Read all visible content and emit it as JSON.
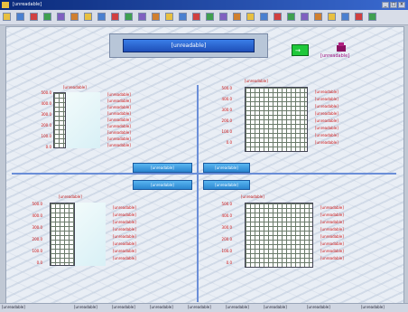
{
  "window": {
    "title": "[unreadable]",
    "controls": [
      "_",
      "□",
      "×"
    ]
  },
  "toolbar": {
    "icons": [
      "open-icon",
      "save-icon",
      "print-icon",
      "copy-icon",
      "cut-icon",
      "paste-icon",
      "undo-icon",
      "redo-icon",
      "arrow-icon",
      "arrow-icon",
      "arrow-icon",
      "arrow-icon",
      "zoom-icon",
      "zoom-icon",
      "chart-icon",
      "window-icon",
      "window-icon",
      "window-icon",
      "grid-icon",
      "table-icon",
      "folder-icon",
      "disk-icon",
      "warning-icon",
      "help-icon",
      "gear-icon",
      "info-icon",
      "arrow-icon",
      "close-icon"
    ]
  },
  "header": {
    "banner_title": "[unreadable]",
    "exit_icon": "→",
    "logo_text": "[unreadable]"
  },
  "center_buttons": {
    "top_left": "[unreadable]",
    "top_right": "[unreadable]",
    "bottom_left": "[unreadable]",
    "bottom_right": "[unreadable]"
  },
  "panels": {
    "tl": {
      "title": "[unreadable]",
      "yticks": [
        "500.0",
        "400.0",
        "300.0",
        "200.0",
        "100.0",
        "0.0"
      ],
      "annotations": [
        "[unreadable]",
        "[unreadable]",
        "[unreadable]",
        "[unreadable]",
        "[unreadable]",
        "[unreadable]",
        "[unreadable]",
        "[unreadable]",
        "[unreadable]"
      ]
    },
    "tr": {
      "title": "[unreadable]",
      "yticks": [
        "500.0",
        "400.0",
        "300.0",
        "200.0",
        "100.0",
        "0.0"
      ],
      "annotations": [
        "[unreadable]",
        "[unreadable]",
        "[unreadable]",
        "[unreadable]",
        "[unreadable]",
        "[unreadable]",
        "[unreadable]",
        "[unreadable]"
      ]
    },
    "bl": {
      "title": "[unreadable]",
      "yticks": [
        "500.0",
        "400.0",
        "300.0",
        "200.0",
        "100.0",
        "0.0"
      ],
      "annotations": [
        "[unreadable]",
        "[unreadable]",
        "[unreadable]",
        "[unreadable]",
        "[unreadable]",
        "[unreadable]",
        "[unreadable]",
        "[unreadable]"
      ]
    },
    "br": {
      "title": "[unreadable]",
      "yticks": [
        "500.0",
        "400.0",
        "300.0",
        "200.0",
        "100.0",
        "0.0"
      ],
      "annotations": [
        "[unreadable]",
        "[unreadable]",
        "[unreadable]",
        "[unreadable]",
        "[unreadable]",
        "[unreadable]",
        "[unreadable]",
        "[unreadable]"
      ]
    }
  },
  "statusbar": {
    "items": [
      "[unreadable]",
      "[unreadable]",
      "[unreadable]",
      "[unreadable]",
      "[unreadable]",
      "[unreadable]",
      "[unreadable]",
      "[unreadable]",
      "[unreadable]"
    ]
  },
  "colors": {
    "accent": "#2a86d0",
    "banner": "#1f4fb8",
    "separator": "#6a8ed8",
    "label": "#d01010",
    "exit": "#1fc83a"
  }
}
